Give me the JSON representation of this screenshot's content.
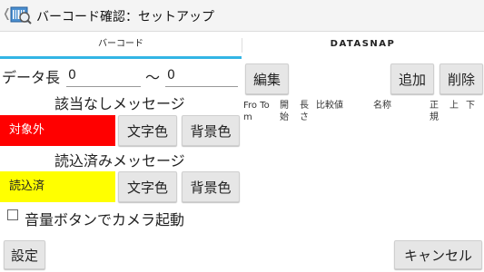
{
  "header": {
    "title": "バーコード確認：セットアップ",
    "back_glyph": "❬"
  },
  "tabs": [
    {
      "label": "バーコード",
      "active": true
    },
    {
      "label": "DATASNAP",
      "active": false
    }
  ],
  "range": {
    "label": "データ長",
    "from_value": "0",
    "separator": "〜",
    "to_value": "0"
  },
  "no_match": {
    "heading": "該当なしメッセージ",
    "message": "対象外",
    "message_bg": "#ff0000",
    "message_color": "#ffffff",
    "text_color_button": "文字色",
    "bg_color_button": "背景色"
  },
  "scanned": {
    "heading": "読込済みメッセージ",
    "message": "読込済",
    "message_bg": "#ffff00",
    "message_color": "#222222",
    "text_color_button": "文字色",
    "bg_color_button": "背景色"
  },
  "option": {
    "label": "音量ボタンでカメラ起動",
    "checked": false
  },
  "right_panel": {
    "edit_button": "編集",
    "add_button": "追加",
    "delete_button": "削除",
    "columns": [
      "Fro To\nm",
      "開\n始",
      "長\nさ",
      "比較値",
      "名称",
      "正\n規",
      "上",
      "下"
    ]
  },
  "footer": {
    "settings_button": "設定",
    "cancel_button": "キャンセル"
  },
  "colors": {
    "accent": "#33b5e5"
  }
}
